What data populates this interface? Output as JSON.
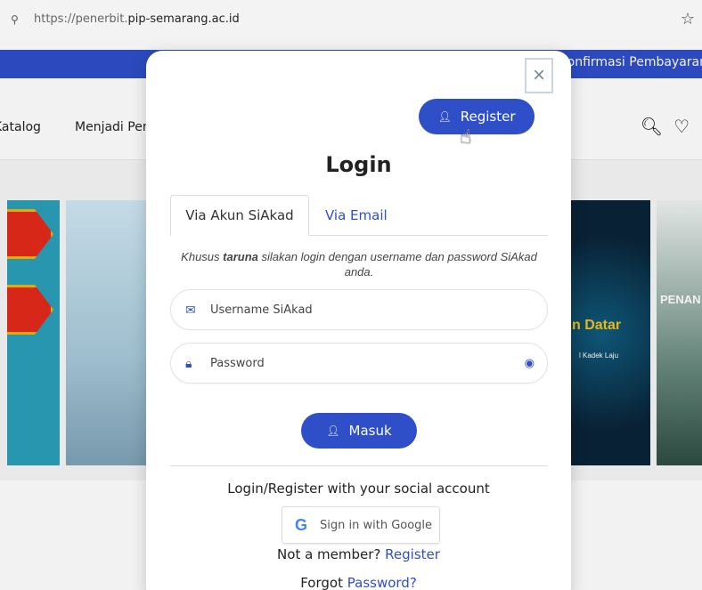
{
  "browser": {
    "url_prefix": "https://penerbit.",
    "url_domain": "pip-semarang.ac.id",
    "site_icon": "tune-icon",
    "star_icon": "star-icon"
  },
  "page": {
    "topbar_right": "Konfirmasi Pembayaran",
    "nav_items": [
      "Katalog",
      "Menjadi Pen"
    ],
    "books": {
      "b3_title": "n Datar",
      "b3_authors": "l Kadek Laju",
      "b4_title": "PENAN"
    }
  },
  "modal": {
    "close_label": "×",
    "register_label": "Register",
    "title": "Login",
    "tabs": [
      "Via Akun SiAkad",
      "Via Email"
    ],
    "note_pre": "Khusus ",
    "note_bold": "taruna",
    "note_post": " silakan login dengan username dan password SiAkad anda.",
    "username_placeholder": "Username SiAkad",
    "password_placeholder": "Password",
    "submit_label": "Masuk",
    "social_title": "Login/Register with your social account",
    "google_label": "Sign in with Google",
    "not_member": "Not a member?",
    "not_member_link": "Register",
    "forgot_prefix": "Forgot",
    "forgot_link": "Password?"
  },
  "colors": {
    "primary": "#2f4fc9",
    "topbar": "#2f4fc9"
  }
}
